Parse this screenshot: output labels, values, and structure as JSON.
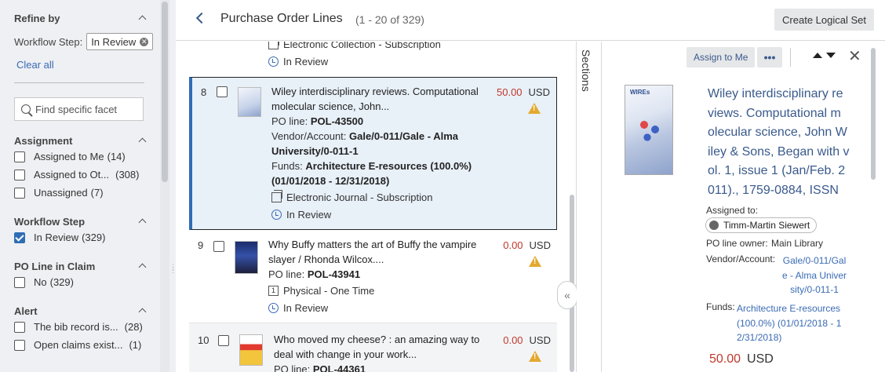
{
  "sidebar": {
    "refine_label": "Refine by",
    "workflow_filter_label": "Workflow Step:",
    "workflow_filter_value": "In Review",
    "clear_all": "Clear all",
    "search_placeholder": "Find specific facet",
    "groups": [
      {
        "title": "Assignment",
        "items": [
          {
            "label": "Assigned to Me",
            "count": "(14)",
            "checked": false
          },
          {
            "label": "Assigned to Ot...",
            "count": "(308)",
            "checked": false
          },
          {
            "label": "Unassigned",
            "count": "(7)",
            "checked": false
          }
        ]
      },
      {
        "title": "Workflow Step",
        "items": [
          {
            "label": "In Review",
            "count": "(329)",
            "checked": true
          }
        ]
      },
      {
        "title": "PO Line in Claim",
        "items": [
          {
            "label": "No",
            "count": "(329)",
            "checked": false
          }
        ]
      },
      {
        "title": "Alert",
        "items": [
          {
            "label": "The bib record is...",
            "count": "(28)",
            "checked": false
          },
          {
            "label": "Open claims exist...",
            "count": "(1)",
            "checked": false
          }
        ]
      }
    ]
  },
  "header": {
    "title": "Purchase Order Lines",
    "count": "(1 - 20 of 329)",
    "create_button": "Create Logical Set"
  },
  "list": {
    "partial_top": {
      "type": "Electronic Collection - Subscription",
      "status": "In Review"
    },
    "rows": [
      {
        "num": "8",
        "title": "Wiley interdisciplinary reviews. Computational molecular science, John...",
        "po_label": "PO line:",
        "po": "POL-43500",
        "vendor_label": "Vendor/Account:",
        "vendor": "Gale/0-011/Gale - Alma University/0-011-1",
        "funds_label": "Funds:",
        "funds": "Architecture E-resources (100.0%) (01/01/2018 - 12/31/2018)",
        "type": "Electronic Journal - Subscription",
        "status": "In Review",
        "price": "50.00",
        "currency": "USD"
      },
      {
        "num": "9",
        "title": "Why Buffy matters the art of Buffy the vampire slayer / Rhonda Wilcox....",
        "po_label": "PO line:",
        "po": "POL-43941",
        "type_box": "1",
        "type": "Physical - One Time",
        "status": "In Review",
        "price": "0.00",
        "currency": "USD"
      },
      {
        "num": "10",
        "title": "Who moved my cheese? : an amazing way to deal with change in your work...",
        "po_label": "PO line:",
        "po": "POL-44361",
        "price": "0.00",
        "currency": "USD"
      }
    ]
  },
  "sections_label": "Sections",
  "details": {
    "assign_button": "Assign to Me",
    "more_button": "•••",
    "close": "✕",
    "cover_brand": "WIREs",
    "title_lines": [
      "Wiley interdisciplinary re",
      "views. Computational m",
      "olecular science, John W",
      "iley & Sons, Began with v",
      "ol. 1, issue 1 (Jan/Feb. 2",
      "011)., 1759-0884, ISSN"
    ],
    "assigned_label": "Assigned to:",
    "assigned_user": "Timm-Martin Siewert",
    "owner_label": "PO line owner:",
    "owner": "Main Library",
    "vendor_label": "Vendor/Account:",
    "vendor_lines": [
      "Gale/0-011/Gal",
      "e - Alma Univer",
      "sity/0-011-1"
    ],
    "funds_label": "Funds:",
    "funds_lines": [
      "Architecture E-resources",
      "(100.0%) (01/01/2018 - 1",
      "2/31/2018)"
    ],
    "price": "50.00",
    "currency": "USD"
  },
  "colors": {
    "accent": "#2f6db5",
    "price_red": "#c0392b",
    "warning": "#e3a92e",
    "link": "#3a6bb4"
  }
}
